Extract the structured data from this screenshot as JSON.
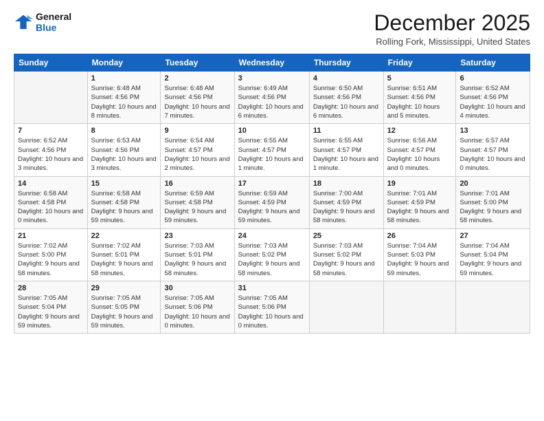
{
  "logo": {
    "line1": "General",
    "line2": "Blue"
  },
  "title": "December 2025",
  "location": "Rolling Fork, Mississippi, United States",
  "weekdays": [
    "Sunday",
    "Monday",
    "Tuesday",
    "Wednesday",
    "Thursday",
    "Friday",
    "Saturday"
  ],
  "weeks": [
    [
      {
        "day": "",
        "sunrise": "",
        "sunset": "",
        "daylight": ""
      },
      {
        "day": "1",
        "sunrise": "Sunrise: 6:48 AM",
        "sunset": "Sunset: 4:56 PM",
        "daylight": "Daylight: 10 hours and 8 minutes."
      },
      {
        "day": "2",
        "sunrise": "Sunrise: 6:48 AM",
        "sunset": "Sunset: 4:56 PM",
        "daylight": "Daylight: 10 hours and 7 minutes."
      },
      {
        "day": "3",
        "sunrise": "Sunrise: 6:49 AM",
        "sunset": "Sunset: 4:56 PM",
        "daylight": "Daylight: 10 hours and 6 minutes."
      },
      {
        "day": "4",
        "sunrise": "Sunrise: 6:50 AM",
        "sunset": "Sunset: 4:56 PM",
        "daylight": "Daylight: 10 hours and 6 minutes."
      },
      {
        "day": "5",
        "sunrise": "Sunrise: 6:51 AM",
        "sunset": "Sunset: 4:56 PM",
        "daylight": "Daylight: 10 hours and 5 minutes."
      },
      {
        "day": "6",
        "sunrise": "Sunrise: 6:52 AM",
        "sunset": "Sunset: 4:56 PM",
        "daylight": "Daylight: 10 hours and 4 minutes."
      }
    ],
    [
      {
        "day": "7",
        "sunrise": "Sunrise: 6:52 AM",
        "sunset": "Sunset: 4:56 PM",
        "daylight": "Daylight: 10 hours and 3 minutes."
      },
      {
        "day": "8",
        "sunrise": "Sunrise: 6:53 AM",
        "sunset": "Sunset: 4:56 PM",
        "daylight": "Daylight: 10 hours and 3 minutes."
      },
      {
        "day": "9",
        "sunrise": "Sunrise: 6:54 AM",
        "sunset": "Sunset: 4:57 PM",
        "daylight": "Daylight: 10 hours and 2 minutes."
      },
      {
        "day": "10",
        "sunrise": "Sunrise: 6:55 AM",
        "sunset": "Sunset: 4:57 PM",
        "daylight": "Daylight: 10 hours and 1 minute."
      },
      {
        "day": "11",
        "sunrise": "Sunrise: 6:55 AM",
        "sunset": "Sunset: 4:57 PM",
        "daylight": "Daylight: 10 hours and 1 minute."
      },
      {
        "day": "12",
        "sunrise": "Sunrise: 6:56 AM",
        "sunset": "Sunset: 4:57 PM",
        "daylight": "Daylight: 10 hours and 0 minutes."
      },
      {
        "day": "13",
        "sunrise": "Sunrise: 6:57 AM",
        "sunset": "Sunset: 4:57 PM",
        "daylight": "Daylight: 10 hours and 0 minutes."
      }
    ],
    [
      {
        "day": "14",
        "sunrise": "Sunrise: 6:58 AM",
        "sunset": "Sunset: 4:58 PM",
        "daylight": "Daylight: 10 hours and 0 minutes."
      },
      {
        "day": "15",
        "sunrise": "Sunrise: 6:58 AM",
        "sunset": "Sunset: 4:58 PM",
        "daylight": "Daylight: 9 hours and 59 minutes."
      },
      {
        "day": "16",
        "sunrise": "Sunrise: 6:59 AM",
        "sunset": "Sunset: 4:58 PM",
        "daylight": "Daylight: 9 hours and 59 minutes."
      },
      {
        "day": "17",
        "sunrise": "Sunrise: 6:59 AM",
        "sunset": "Sunset: 4:59 PM",
        "daylight": "Daylight: 9 hours and 59 minutes."
      },
      {
        "day": "18",
        "sunrise": "Sunrise: 7:00 AM",
        "sunset": "Sunset: 4:59 PM",
        "daylight": "Daylight: 9 hours and 58 minutes."
      },
      {
        "day": "19",
        "sunrise": "Sunrise: 7:01 AM",
        "sunset": "Sunset: 4:59 PM",
        "daylight": "Daylight: 9 hours and 58 minutes."
      },
      {
        "day": "20",
        "sunrise": "Sunrise: 7:01 AM",
        "sunset": "Sunset: 5:00 PM",
        "daylight": "Daylight: 9 hours and 58 minutes."
      }
    ],
    [
      {
        "day": "21",
        "sunrise": "Sunrise: 7:02 AM",
        "sunset": "Sunset: 5:00 PM",
        "daylight": "Daylight: 9 hours and 58 minutes."
      },
      {
        "day": "22",
        "sunrise": "Sunrise: 7:02 AM",
        "sunset": "Sunset: 5:01 PM",
        "daylight": "Daylight: 9 hours and 58 minutes."
      },
      {
        "day": "23",
        "sunrise": "Sunrise: 7:03 AM",
        "sunset": "Sunset: 5:01 PM",
        "daylight": "Daylight: 9 hours and 58 minutes."
      },
      {
        "day": "24",
        "sunrise": "Sunrise: 7:03 AM",
        "sunset": "Sunset: 5:02 PM",
        "daylight": "Daylight: 9 hours and 58 minutes."
      },
      {
        "day": "25",
        "sunrise": "Sunrise: 7:03 AM",
        "sunset": "Sunset: 5:02 PM",
        "daylight": "Daylight: 9 hours and 58 minutes."
      },
      {
        "day": "26",
        "sunrise": "Sunrise: 7:04 AM",
        "sunset": "Sunset: 5:03 PM",
        "daylight": "Daylight: 9 hours and 59 minutes."
      },
      {
        "day": "27",
        "sunrise": "Sunrise: 7:04 AM",
        "sunset": "Sunset: 5:04 PM",
        "daylight": "Daylight: 9 hours and 59 minutes."
      }
    ],
    [
      {
        "day": "28",
        "sunrise": "Sunrise: 7:05 AM",
        "sunset": "Sunset: 5:04 PM",
        "daylight": "Daylight: 9 hours and 59 minutes."
      },
      {
        "day": "29",
        "sunrise": "Sunrise: 7:05 AM",
        "sunset": "Sunset: 5:05 PM",
        "daylight": "Daylight: 9 hours and 59 minutes."
      },
      {
        "day": "30",
        "sunrise": "Sunrise: 7:05 AM",
        "sunset": "Sunset: 5:06 PM",
        "daylight": "Daylight: 10 hours and 0 minutes."
      },
      {
        "day": "31",
        "sunrise": "Sunrise: 7:05 AM",
        "sunset": "Sunset: 5:06 PM",
        "daylight": "Daylight: 10 hours and 0 minutes."
      },
      {
        "day": "",
        "sunrise": "",
        "sunset": "",
        "daylight": ""
      },
      {
        "day": "",
        "sunrise": "",
        "sunset": "",
        "daylight": ""
      },
      {
        "day": "",
        "sunrise": "",
        "sunset": "",
        "daylight": ""
      }
    ]
  ]
}
